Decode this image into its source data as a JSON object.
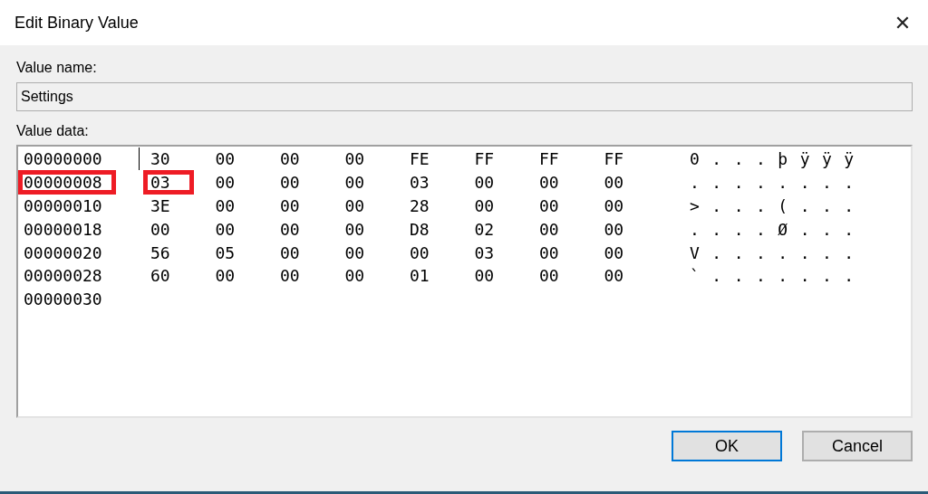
{
  "window": {
    "title": "Edit Binary Value",
    "close": "✕"
  },
  "value_name": {
    "label": "Value name:",
    "value": "Settings"
  },
  "value_data": {
    "label": "Value data:",
    "caret": true,
    "rows": [
      {
        "address": "00000000",
        "address_highlighted": false,
        "bytes": [
          {
            "value": "30",
            "highlighted": false
          },
          {
            "value": "00",
            "highlighted": false
          },
          {
            "value": "00",
            "highlighted": false
          },
          {
            "value": "00",
            "highlighted": false
          },
          {
            "value": "FE",
            "highlighted": false
          },
          {
            "value": "FF",
            "highlighted": false
          },
          {
            "value": "FF",
            "highlighted": false
          },
          {
            "value": "FF",
            "highlighted": false
          }
        ],
        "ascii": "0...þÿÿÿ"
      },
      {
        "address": "00000008",
        "address_highlighted": true,
        "bytes": [
          {
            "value": "03",
            "highlighted": true
          },
          {
            "value": "00",
            "highlighted": false
          },
          {
            "value": "00",
            "highlighted": false
          },
          {
            "value": "00",
            "highlighted": false
          },
          {
            "value": "03",
            "highlighted": false
          },
          {
            "value": "00",
            "highlighted": false
          },
          {
            "value": "00",
            "highlighted": false
          },
          {
            "value": "00",
            "highlighted": false
          }
        ],
        "ascii": "........"
      },
      {
        "address": "00000010",
        "address_highlighted": false,
        "bytes": [
          {
            "value": "3E",
            "highlighted": false
          },
          {
            "value": "00",
            "highlighted": false
          },
          {
            "value": "00",
            "highlighted": false
          },
          {
            "value": "00",
            "highlighted": false
          },
          {
            "value": "28",
            "highlighted": false
          },
          {
            "value": "00",
            "highlighted": false
          },
          {
            "value": "00",
            "highlighted": false
          },
          {
            "value": "00",
            "highlighted": false
          }
        ],
        "ascii": ">...(..."
      },
      {
        "address": "00000018",
        "address_highlighted": false,
        "bytes": [
          {
            "value": "00",
            "highlighted": false
          },
          {
            "value": "00",
            "highlighted": false
          },
          {
            "value": "00",
            "highlighted": false
          },
          {
            "value": "00",
            "highlighted": false
          },
          {
            "value": "D8",
            "highlighted": false
          },
          {
            "value": "02",
            "highlighted": false
          },
          {
            "value": "00",
            "highlighted": false
          },
          {
            "value": "00",
            "highlighted": false
          }
        ],
        "ascii": "....Ø..."
      },
      {
        "address": "00000020",
        "address_highlighted": false,
        "bytes": [
          {
            "value": "56",
            "highlighted": false
          },
          {
            "value": "05",
            "highlighted": false
          },
          {
            "value": "00",
            "highlighted": false
          },
          {
            "value": "00",
            "highlighted": false
          },
          {
            "value": "00",
            "highlighted": false
          },
          {
            "value": "03",
            "highlighted": false
          },
          {
            "value": "00",
            "highlighted": false
          },
          {
            "value": "00",
            "highlighted": false
          }
        ],
        "ascii": "V......."
      },
      {
        "address": "00000028",
        "address_highlighted": false,
        "bytes": [
          {
            "value": "60",
            "highlighted": false
          },
          {
            "value": "00",
            "highlighted": false
          },
          {
            "value": "00",
            "highlighted": false
          },
          {
            "value": "00",
            "highlighted": false
          },
          {
            "value": "01",
            "highlighted": false
          },
          {
            "value": "00",
            "highlighted": false
          },
          {
            "value": "00",
            "highlighted": false
          },
          {
            "value": "00",
            "highlighted": false
          }
        ],
        "ascii": "`......."
      },
      {
        "address": "00000030",
        "address_highlighted": false,
        "bytes": [],
        "ascii": ""
      }
    ]
  },
  "buttons": [
    {
      "label": "OK",
      "default": true
    },
    {
      "label": "Cancel",
      "default": false
    }
  ]
}
